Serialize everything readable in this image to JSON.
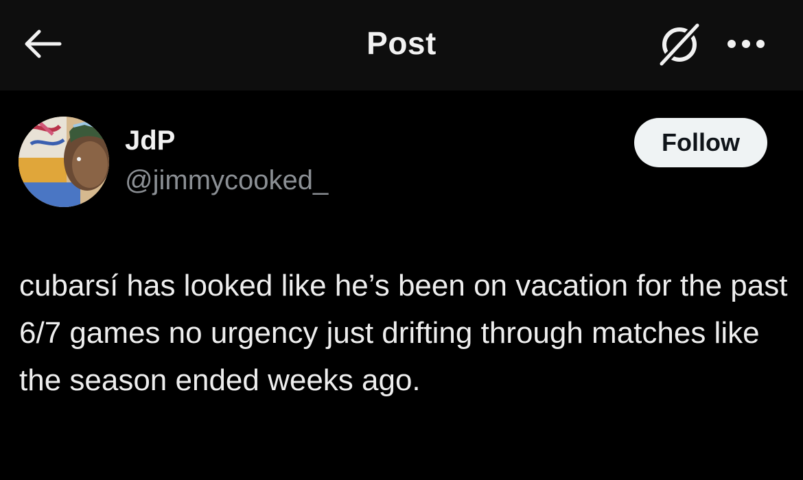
{
  "header": {
    "title": "Post",
    "back_icon": "arrow-left-icon",
    "grok_icon": "grok-slash-icon",
    "more_icon": "more-horizontal-icon"
  },
  "author": {
    "display_name": "JdP",
    "handle": "@jimmycooked_",
    "avatar": "avatar-image"
  },
  "follow_button": {
    "label": "Follow"
  },
  "post": {
    "text": "cubarsí has looked like he’s been on vacation for the past 6/7 games no urgency just drifting through matches like the season ended weeks ago."
  },
  "colors": {
    "background": "#000000",
    "header_background": "#0e0e0e",
    "text_primary": "#eeeeee",
    "text_secondary": "#8b8f94",
    "follow_bg": "#eff3f4",
    "follow_text": "#0f1419"
  }
}
